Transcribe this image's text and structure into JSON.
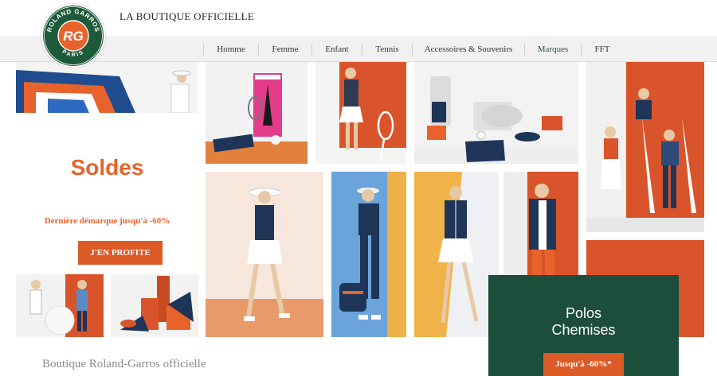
{
  "header": {
    "site_title": "LA BOUTIQUE OFFICIELLE",
    "logo": {
      "text_top": "ROLAND GARROS",
      "text_bottom": "PARIS",
      "monogram": "RG",
      "color": "#1d5a3a",
      "accent": "#e8632b"
    }
  },
  "nav": {
    "items": [
      {
        "label": "Homme"
      },
      {
        "label": "Femme"
      },
      {
        "label": "Enfant"
      },
      {
        "label": "Tennis"
      },
      {
        "label": "Accessoires & Souvenirs"
      },
      {
        "label": "Marques",
        "active": true
      },
      {
        "label": "FFT"
      }
    ]
  },
  "promo": {
    "headline": "Soldes",
    "subtext": "Dernière démarque jusqu'à -60%",
    "cta": "J'EN PROFITE"
  },
  "green_card": {
    "line1": "Polos",
    "line2": "Chemises",
    "cta": "Jusqu'à -60%*"
  },
  "footer": {
    "text": "Boutique Roland-Garros officielle"
  },
  "colors": {
    "brand_green": "#1d4e3b",
    "brand_orange": "#dc5a26",
    "clay": "#d9542a"
  }
}
